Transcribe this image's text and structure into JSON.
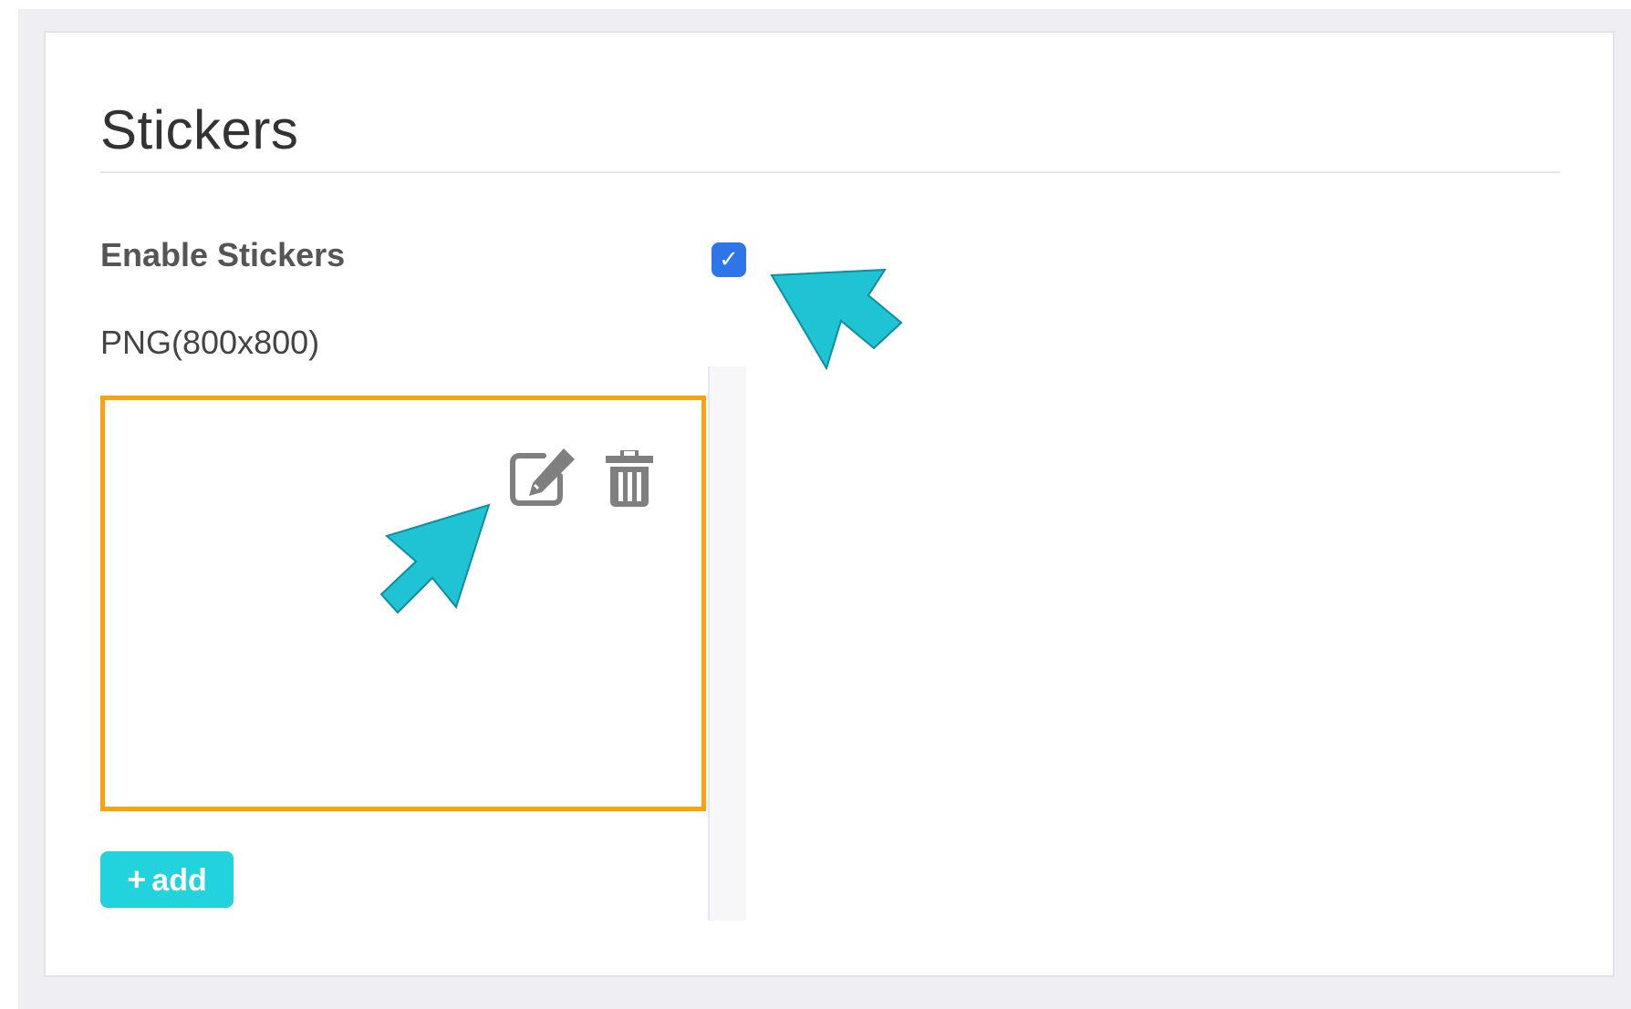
{
  "section": {
    "title": "Stickers"
  },
  "settings": {
    "enable_label": "Enable Stickers",
    "enable_checked": true,
    "check_glyph": "✓",
    "format_label": "PNG(800x800)"
  },
  "sticker_item": {
    "border_color": "#ffa00d",
    "edit_icon": "edit-icon",
    "delete_icon": "trash-icon"
  },
  "actions": {
    "add_plus": "+",
    "add_label": "add"
  },
  "annotations": {
    "arrow_color": "#1fc3d3",
    "checkbox_color": "#2d75e8",
    "add_button_color": "#22d2dc"
  }
}
